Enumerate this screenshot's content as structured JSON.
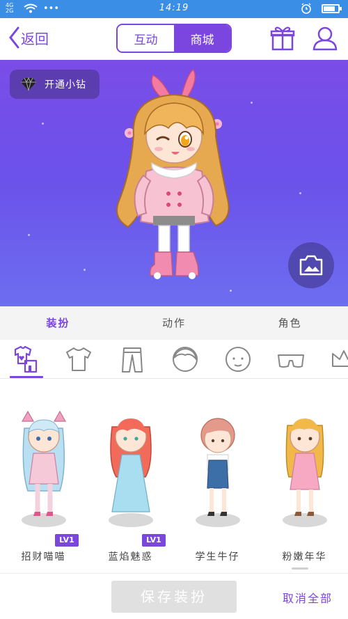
{
  "status_bar": {
    "signal": "4G 2G",
    "dots": "•••",
    "time": "14:19"
  },
  "nav": {
    "back_label": "返回",
    "tabs": [
      {
        "label": "互动",
        "active": false
      },
      {
        "label": "商城",
        "active": true
      }
    ],
    "icons": [
      "gift-icon",
      "profile-icon"
    ]
  },
  "stage": {
    "vip_label": "开通小钻",
    "icons": [
      "diamond-icon",
      "camera-icon"
    ]
  },
  "categories": [
    {
      "label": "装扮",
      "selected": true
    },
    {
      "label": "动作",
      "selected": false
    },
    {
      "label": "角色",
      "selected": false
    }
  ],
  "item_icons": [
    "suit-icon",
    "tshirt-icon",
    "pants-icon",
    "hair-icon",
    "face-icon",
    "glasses-icon",
    "crown-icon"
  ],
  "outfits": [
    {
      "name": "招财喵喵",
      "badge": "LV1"
    },
    {
      "name": "蓝焰魅惑",
      "badge": "LV1"
    },
    {
      "name": "学生牛仔",
      "badge": ""
    },
    {
      "name": "粉嫩年华",
      "badge": ""
    }
  ],
  "bottom": {
    "save_label": "保存装扮",
    "cancel_label": "取消全部"
  },
  "colors": {
    "accent": "#7b45e0",
    "stage_top": "#7a4ce8",
    "stage_bottom": "#6d6ef0",
    "status_bar": "#3a8ee6"
  }
}
